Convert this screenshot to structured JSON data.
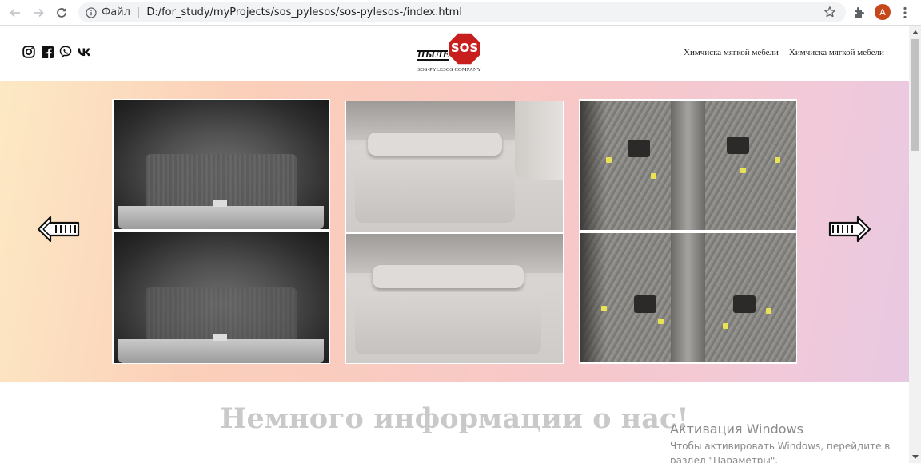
{
  "browser": {
    "site_label": "Файл",
    "separator": "|",
    "url": "D:/for_study/myProjects/sos_pylesos/sos-pylesos-/index.html",
    "avatar_letter": "A"
  },
  "header": {
    "logo_word": "ПЫЛЕ",
    "logo_sign": "SOS",
    "logo_company": "SOS-PYLESOS COMPANY",
    "nav": [
      {
        "label": "Химчиска мягкой мебели"
      },
      {
        "label": "Химчиска мягкой мебели"
      }
    ],
    "socials": [
      "instagram-icon",
      "facebook-icon",
      "viber-icon",
      "vk-icon"
    ]
  },
  "gallery": {
    "photos": [
      "car-trunk-before-after",
      "sofa-before-after",
      "car-floor-before-after"
    ]
  },
  "about": {
    "heading": "Немного информации о нас!"
  },
  "watermark": {
    "title": "Активация Windows",
    "line1": "Чтобы активировать Windows, перейдите в",
    "line2": "раздел \"Параметры\"."
  },
  "colors": {
    "accent_red": "#c81e1e",
    "avatar": "#c5471a",
    "gallery_gradient_start": "#fde9c4",
    "gallery_gradient_end": "#e8c9e2"
  }
}
